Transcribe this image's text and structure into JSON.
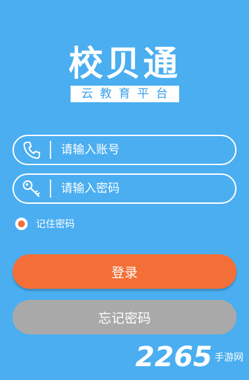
{
  "logo": {
    "title": "校贝通",
    "subtitle": "云教育平台"
  },
  "form": {
    "account_placeholder": "请输入账号",
    "password_placeholder": "请输入密码",
    "remember_label": "记住密码",
    "remember_checked": true
  },
  "buttons": {
    "login_label": "登录",
    "forgot_label": "忘记密码"
  },
  "watermark": {
    "digits": "2265",
    "site": "手游网"
  },
  "colors": {
    "background": "#4aaef0",
    "login_button": "#f36f37",
    "forgot_button": "#a9a9a9"
  },
  "icons": {
    "account": "phone-icon",
    "password": "key-icon"
  }
}
